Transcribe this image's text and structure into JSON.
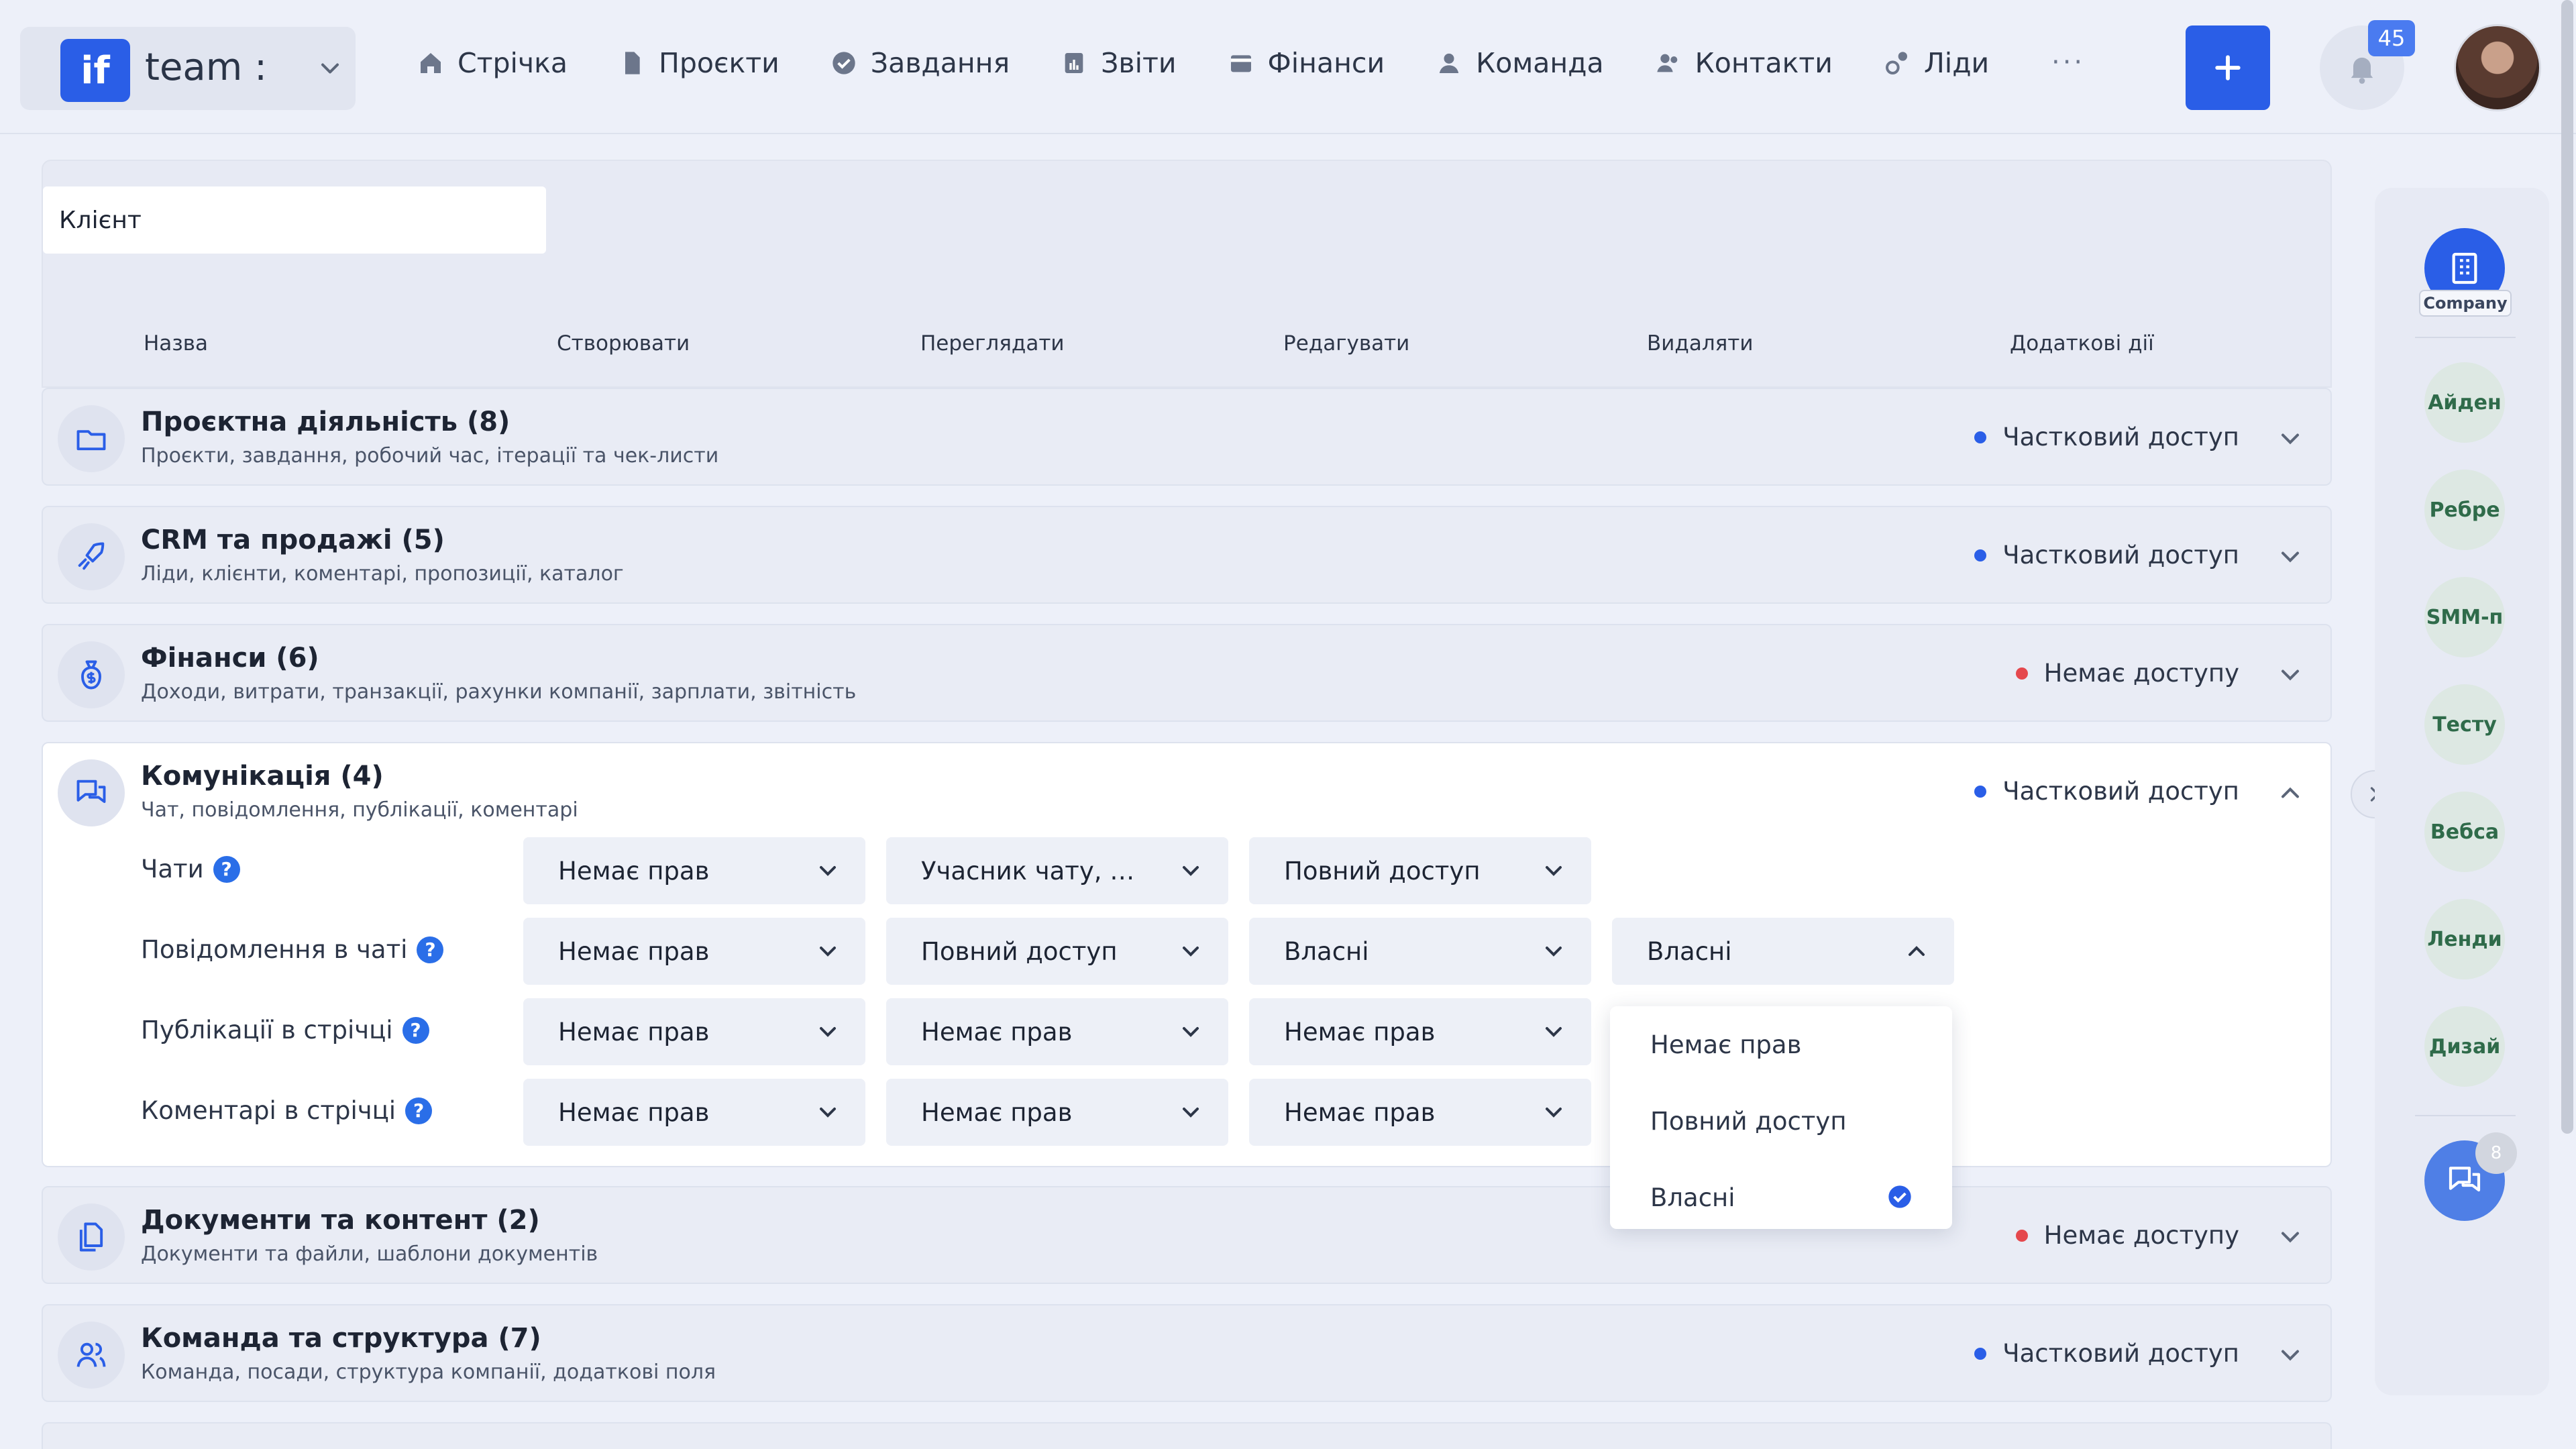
{
  "brand": {
    "logo": "if",
    "name": "team :"
  },
  "nav": [
    {
      "label": "Стрічка",
      "icon": "home-icon"
    },
    {
      "label": "Проєкти",
      "icon": "document-icon"
    },
    {
      "label": "Завдання",
      "icon": "check-circle-icon"
    },
    {
      "label": "Звіти",
      "icon": "report-icon"
    },
    {
      "label": "Фінанси",
      "icon": "wallet-icon"
    },
    {
      "label": "Команда",
      "icon": "user-icon"
    },
    {
      "label": "Контакти",
      "icon": "contacts-icon"
    },
    {
      "label": "Ліди",
      "icon": "leads-icon"
    }
  ],
  "nav_more": "···",
  "notifications": {
    "count": "45"
  },
  "header": {
    "client_label": "Клієнт",
    "columns": [
      "Назва",
      "Створювати",
      "Переглядати",
      "Редагувати",
      "Видаляти",
      "Додаткові дії"
    ]
  },
  "sections": [
    {
      "title": "Проєктна діяльність (8)",
      "subtitle": "Проєкти, завдання, робочий час, ітерації та чек-листи",
      "status": "Частковий доступ",
      "status_color": "#2a5ee7"
    },
    {
      "title": "CRM та продажі (5)",
      "subtitle": "Ліди, клієнти, коментарі, пропозиції, каталог",
      "status": "Частковий доступ",
      "status_color": "#2a5ee7"
    },
    {
      "title": "Фінанси (6)",
      "subtitle": "Доходи, витрати, транзакції, рахунки компанії, зарплати, звітність",
      "status": "Немає доступу",
      "status_color": "#e5484d"
    },
    {
      "title": "Комунікація (4)",
      "subtitle": "Чат, повідомлення, публікації, коментарі",
      "status": "Частковий доступ",
      "status_color": "#2a5ee7"
    },
    {
      "title": "Документи та контент (2)",
      "subtitle": "Документи та файли, шаблони документів",
      "status": "Немає доступу",
      "status_color": "#e5484d"
    },
    {
      "title": "Команда та структура (7)",
      "subtitle": "Команда, посади, структура компанії, додаткові поля",
      "status": "Частковий доступ",
      "status_color": "#2a5ee7"
    }
  ],
  "permissions": [
    {
      "label": "Чати",
      "create": "Немає прав",
      "view": "Учасник чату, При…",
      "edit": "Повний доступ"
    },
    {
      "label": "Повідомлення в чаті",
      "create": "Немає прав",
      "view": "Повний доступ",
      "edit": "Власні",
      "delete": "Власні"
    },
    {
      "label": "Публікації в стрічці",
      "create": "Немає прав",
      "view": "Немає прав",
      "edit": "Немає прав"
    },
    {
      "label": "Коментарі в стрічці",
      "create": "Немає прав",
      "view": "Немає прав",
      "edit": "Немає прав"
    }
  ],
  "dropdown": {
    "options": [
      "Немає прав",
      "Повний доступ",
      "Власні"
    ],
    "selected": "Власні"
  },
  "rail": {
    "company_label": "Company",
    "items": [
      "Айден",
      "Ребре",
      "SMM-п",
      "Тесту",
      "Вебса",
      "Ленди",
      "Дизай"
    ],
    "chat_badge": "8"
  }
}
